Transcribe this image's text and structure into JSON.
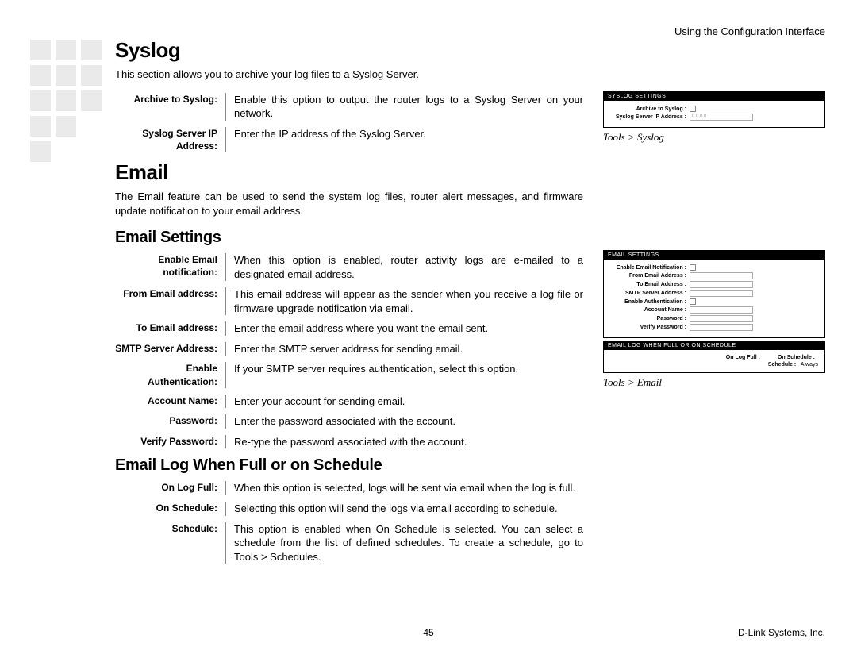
{
  "header_right": "Using the Configuration Interface",
  "footer_page": "45",
  "footer_right": "D-Link Systems, Inc.",
  "syslog": {
    "heading": "Syslog",
    "intro": "This section allows you to archive your log files to a Syslog Server.",
    "rows": [
      {
        "term": "Archive to Syslog:",
        "desc": "Enable this option to output the router logs to a Syslog Server on your network."
      },
      {
        "term": "Syslog Server IP Address:",
        "desc": "Enter the IP address of the Syslog Server."
      }
    ]
  },
  "email": {
    "heading": "Email",
    "intro": "The Email feature can be used to send the system log files, router alert messages, and firmware update notification to your email address."
  },
  "email_settings": {
    "heading": "Email Settings",
    "rows": [
      {
        "term": "Enable Email notification:",
        "desc": "When this option is enabled, router activity logs are e-mailed to a designated email address."
      },
      {
        "term": "From Email address:",
        "desc": "This email address will appear as the sender when you receive a log file or firmware upgrade notification via email."
      },
      {
        "term": "To Email address:",
        "desc": "Enter the email address where you want the email sent."
      },
      {
        "term": "SMTP Server Address:",
        "desc": "Enter the SMTP server address for sending email."
      },
      {
        "term": "Enable Authentication:",
        "desc": "If your SMTP server requires authentication, select this option."
      },
      {
        "term": "Account Name:",
        "desc": "Enter your account for sending email."
      },
      {
        "term": "Password:",
        "desc": "Enter the password associated with the account."
      },
      {
        "term": "Verify Password:",
        "desc": "Re-type the password associated with the account."
      }
    ]
  },
  "email_log": {
    "heading": "Email Log When Full or on Schedule",
    "rows": [
      {
        "term": "On Log Full:",
        "desc": "When this option is selected, logs will be sent via email when the log is full."
      },
      {
        "term": "On Schedule:",
        "desc": "Selecting this option will send the logs via email according to schedule."
      },
      {
        "term": "Schedule:",
        "desc": "This option is enabled when On Schedule is selected. You can select a schedule from the list of defined schedules. To create a schedule, go to Tools > Schedules."
      }
    ]
  },
  "fig1": {
    "panel_title": "SYSLOG SETTINGS",
    "labels": {
      "archive": "Archive to Syslog :",
      "ip": "Syslog Server IP Address :"
    },
    "ip_value": "0.0.0.0",
    "caption": "Tools > Syslog"
  },
  "fig2": {
    "panel1_title": "EMAIL SETTINGS",
    "labels": {
      "enable": "Enable Email Notification :",
      "from": "From Email Address :",
      "to": "To Email Address :",
      "smtp": "SMTP Server Address :",
      "auth": "Enable Authentication :",
      "acct": "Account Name :",
      "pwd": "Password :",
      "vpwd": "Verify Password :"
    },
    "panel2_title": "EMAIL LOG WHEN FULL OR ON SCHEDULE",
    "labels2": {
      "onlogfull": "On Log Full :",
      "onschedule": "On Schedule :",
      "schedule": "Schedule :",
      "schedule_val": "Always"
    },
    "caption": "Tools > Email"
  }
}
